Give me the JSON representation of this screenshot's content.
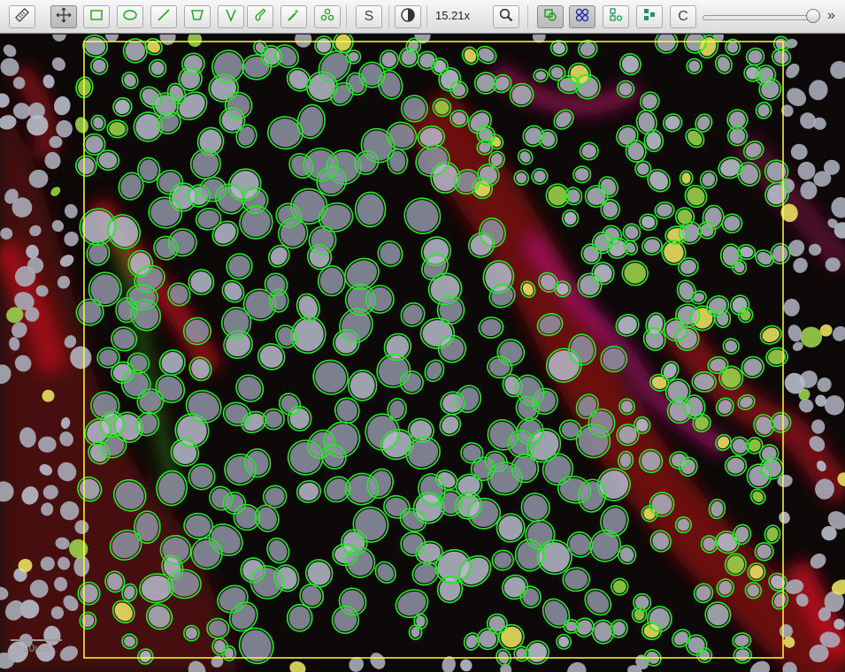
{
  "toolbar": {
    "tools": [
      {
        "name": "ruler-tool-button",
        "icon": "ruler-icon"
      },
      {
        "name": "pan-tool-button",
        "icon": "move-arrows-icon"
      },
      {
        "name": "rectangle-tool-button",
        "icon": "rectangle-icon"
      },
      {
        "name": "ellipse-tool-button",
        "icon": "ellipse-icon"
      },
      {
        "name": "line-tool-button",
        "icon": "line-icon"
      },
      {
        "name": "polygon-tool-button",
        "icon": "polygon-icon"
      },
      {
        "name": "polyline-tool-button",
        "icon": "polyline-v-icon"
      },
      {
        "name": "brush-tool-button",
        "icon": "brush-icon"
      },
      {
        "name": "wand-tool-button",
        "icon": "magic-wand-icon"
      },
      {
        "name": "points-tool-button",
        "icon": "points-icon"
      }
    ],
    "selection_mode_label": "S",
    "brightness_icon": "contrast-icon",
    "zoom_level": "15.21x",
    "zoom_icon": "magnifier-icon",
    "overlay_toggles": [
      {
        "name": "show-annotations-button",
        "icon": "annotations-icon",
        "active": true
      },
      {
        "name": "show-cells-button",
        "icon": "cells-icon",
        "active": true
      },
      {
        "name": "show-cell-centroids-button",
        "icon": "cell-centroids-icon",
        "active": false
      },
      {
        "name": "show-pixel-classification-button",
        "icon": "pixel-classification-icon",
        "active": false
      }
    ],
    "connections_label": "C",
    "opacity_slider_value": 0.95,
    "more_label": "»"
  },
  "viewer": {
    "annotation_color": "#ffff33",
    "detection_color": "#22ee22",
    "scalebar_label": "20µm"
  }
}
